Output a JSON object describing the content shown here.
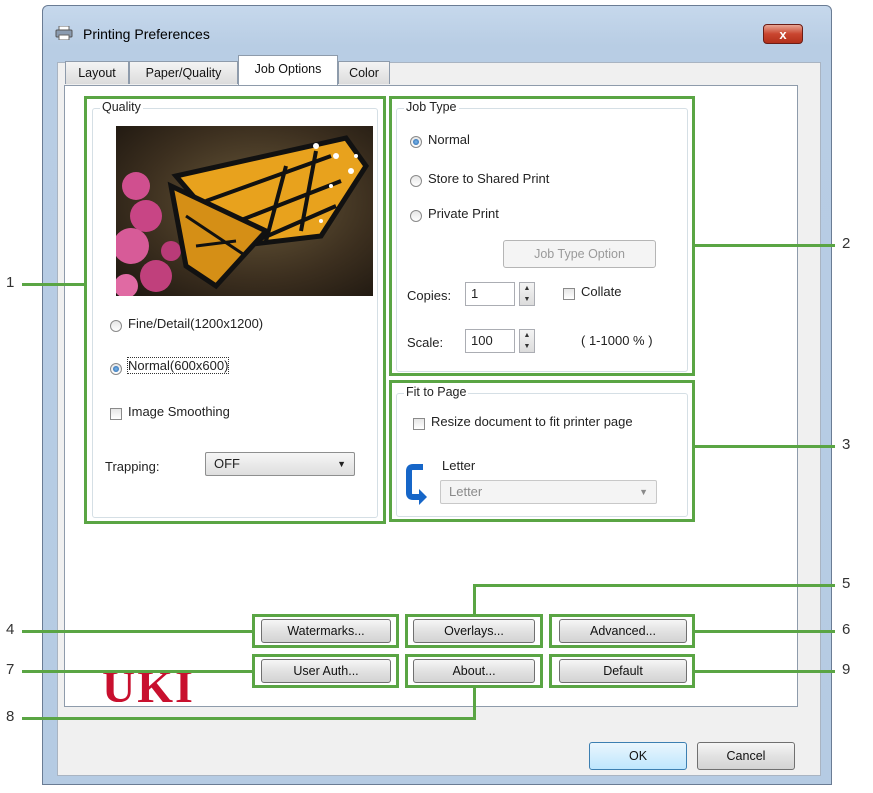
{
  "window": {
    "title": "Printing Preferences",
    "close_glyph": "x"
  },
  "tabs": [
    {
      "label": "Layout",
      "active": false
    },
    {
      "label": "Paper/Quality",
      "active": false
    },
    {
      "label": "Job Options",
      "active": true
    },
    {
      "label": "Color",
      "active": false
    }
  ],
  "quality": {
    "group_label": "Quality",
    "preview_alt": "butterfly-image",
    "options": [
      {
        "label": "Fine/Detail(1200x1200)",
        "selected": false
      },
      {
        "label": "Normal(600x600)",
        "selected": true
      }
    ],
    "image_smoothing_label": "Image Smoothing",
    "image_smoothing_checked": false,
    "trapping_label": "Trapping:",
    "trapping_value": "OFF"
  },
  "job_type": {
    "group_label": "Job Type",
    "options": [
      {
        "label": "Normal",
        "selected": true
      },
      {
        "label": "Store to Shared Print",
        "selected": false
      },
      {
        "label": "Private Print",
        "selected": false
      }
    ],
    "job_type_option_button": "Job Type Option",
    "copies_label": "Copies:",
    "copies_value": "1",
    "collate_label": "Collate",
    "collate_checked": false,
    "scale_label": "Scale:",
    "scale_value": "100",
    "scale_range": "( 1-1000 % )"
  },
  "fit_to_page": {
    "group_label": "Fit to Page",
    "resize_label": "Resize document to fit printer page",
    "resize_checked": false,
    "paper_label": "Letter",
    "paper_value": "Letter"
  },
  "buttons": {
    "watermarks": "Watermarks...",
    "overlays": "Overlays...",
    "advanced": "Advanced...",
    "user_auth": "User Auth...",
    "about": "About...",
    "default": "Default",
    "ok": "OK",
    "cancel": "Cancel"
  },
  "logo_text": "UKI",
  "callouts": [
    "1",
    "2",
    "3",
    "4",
    "5",
    "6",
    "7",
    "8",
    "9"
  ],
  "colors": {
    "highlight": "#5aa544",
    "logo": "#c8102e",
    "titlebar": "#c6d8ec"
  }
}
